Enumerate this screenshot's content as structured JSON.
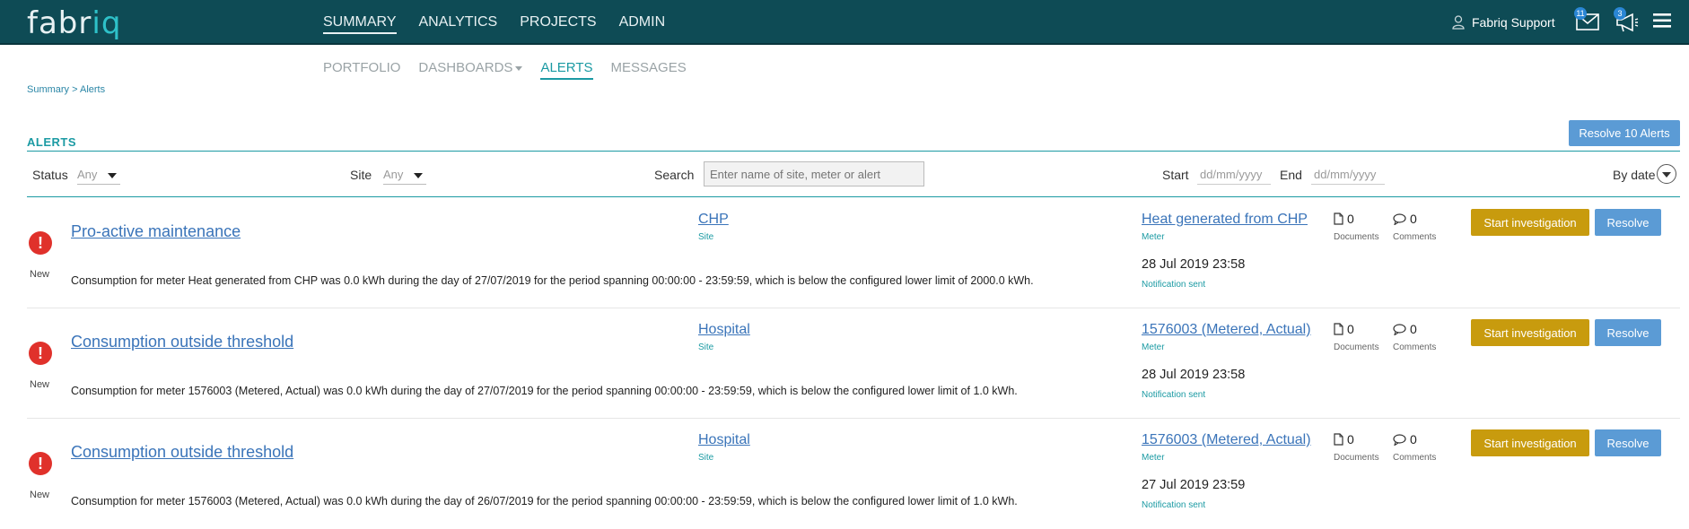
{
  "brand": {
    "logo_main": "fabr",
    "logo_accent": "iq"
  },
  "main_nav": [
    "SUMMARY",
    "ANALYTICS",
    "PROJECTS",
    "ADMIN"
  ],
  "user": {
    "name": "Fabriq Support",
    "mail_badge": "11",
    "announce_badge": "3"
  },
  "sub_nav": [
    "PORTFOLIO",
    "DASHBOARDS",
    "ALERTS",
    "MESSAGES"
  ],
  "breadcrumb": "Summary > Alerts",
  "section": {
    "title": "ALERTS",
    "resolve_all_label": "Resolve 10 Alerts"
  },
  "filters": {
    "status_label": "Status",
    "status_value": "Any",
    "site_label": "Site",
    "site_value": "Any",
    "search_label": "Search",
    "search_placeholder": "Enter name of site, meter or alert",
    "start_label": "Start",
    "start_placeholder": "dd/mm/yyyy",
    "end_label": "End",
    "end_placeholder": "dd/mm/yyyy",
    "sort_label": "By date"
  },
  "labels": {
    "site": "Site",
    "meter": "Meter",
    "documents": "Documents",
    "comments": "Comments",
    "notification": "Notification sent",
    "start_investigation": "Start investigation",
    "resolve": "Resolve"
  },
  "colors": {
    "topbar": "#0e4b55",
    "accent": "#1b9aa3",
    "link": "#3a74b9",
    "alert_red": "#e0312b",
    "investigate": "#c89b0e",
    "resolve": "#5b9bd5"
  },
  "alerts": [
    {
      "status": "New",
      "title": "Pro-active maintenance",
      "description": "Consumption for meter Heat generated from CHP was 0.0 kWh during the day of 27/07/2019 for the period spanning 00:00:00 - 23:59:59, which is below the configured lower limit of 2000.0 kWh.",
      "site": "CHP",
      "meter": "Heat generated from CHP",
      "documents": "0",
      "comments": "0",
      "date": "28 Jul 2019 23:58"
    },
    {
      "status": "New",
      "title": "Consumption outside threshold",
      "description": "Consumption for meter 1576003 (Metered, Actual) was 0.0 kWh during the day of 27/07/2019 for the period spanning 00:00:00 - 23:59:59, which is below the configured lower limit of 1.0 kWh.",
      "site": "Hospital",
      "meter": "1576003 (Metered, Actual)",
      "documents": "0",
      "comments": "0",
      "date": "28 Jul 2019 23:58"
    },
    {
      "status": "New",
      "title": "Consumption outside threshold",
      "description": "Consumption for meter 1576003 (Metered, Actual) was 0.0 kWh during the day of 26/07/2019 for the period spanning 00:00:00 - 23:59:59, which is below the configured lower limit of 1.0 kWh.",
      "site": "Hospital",
      "meter": "1576003 (Metered, Actual)",
      "documents": "0",
      "comments": "0",
      "date": "27 Jul 2019 23:59"
    }
  ]
}
